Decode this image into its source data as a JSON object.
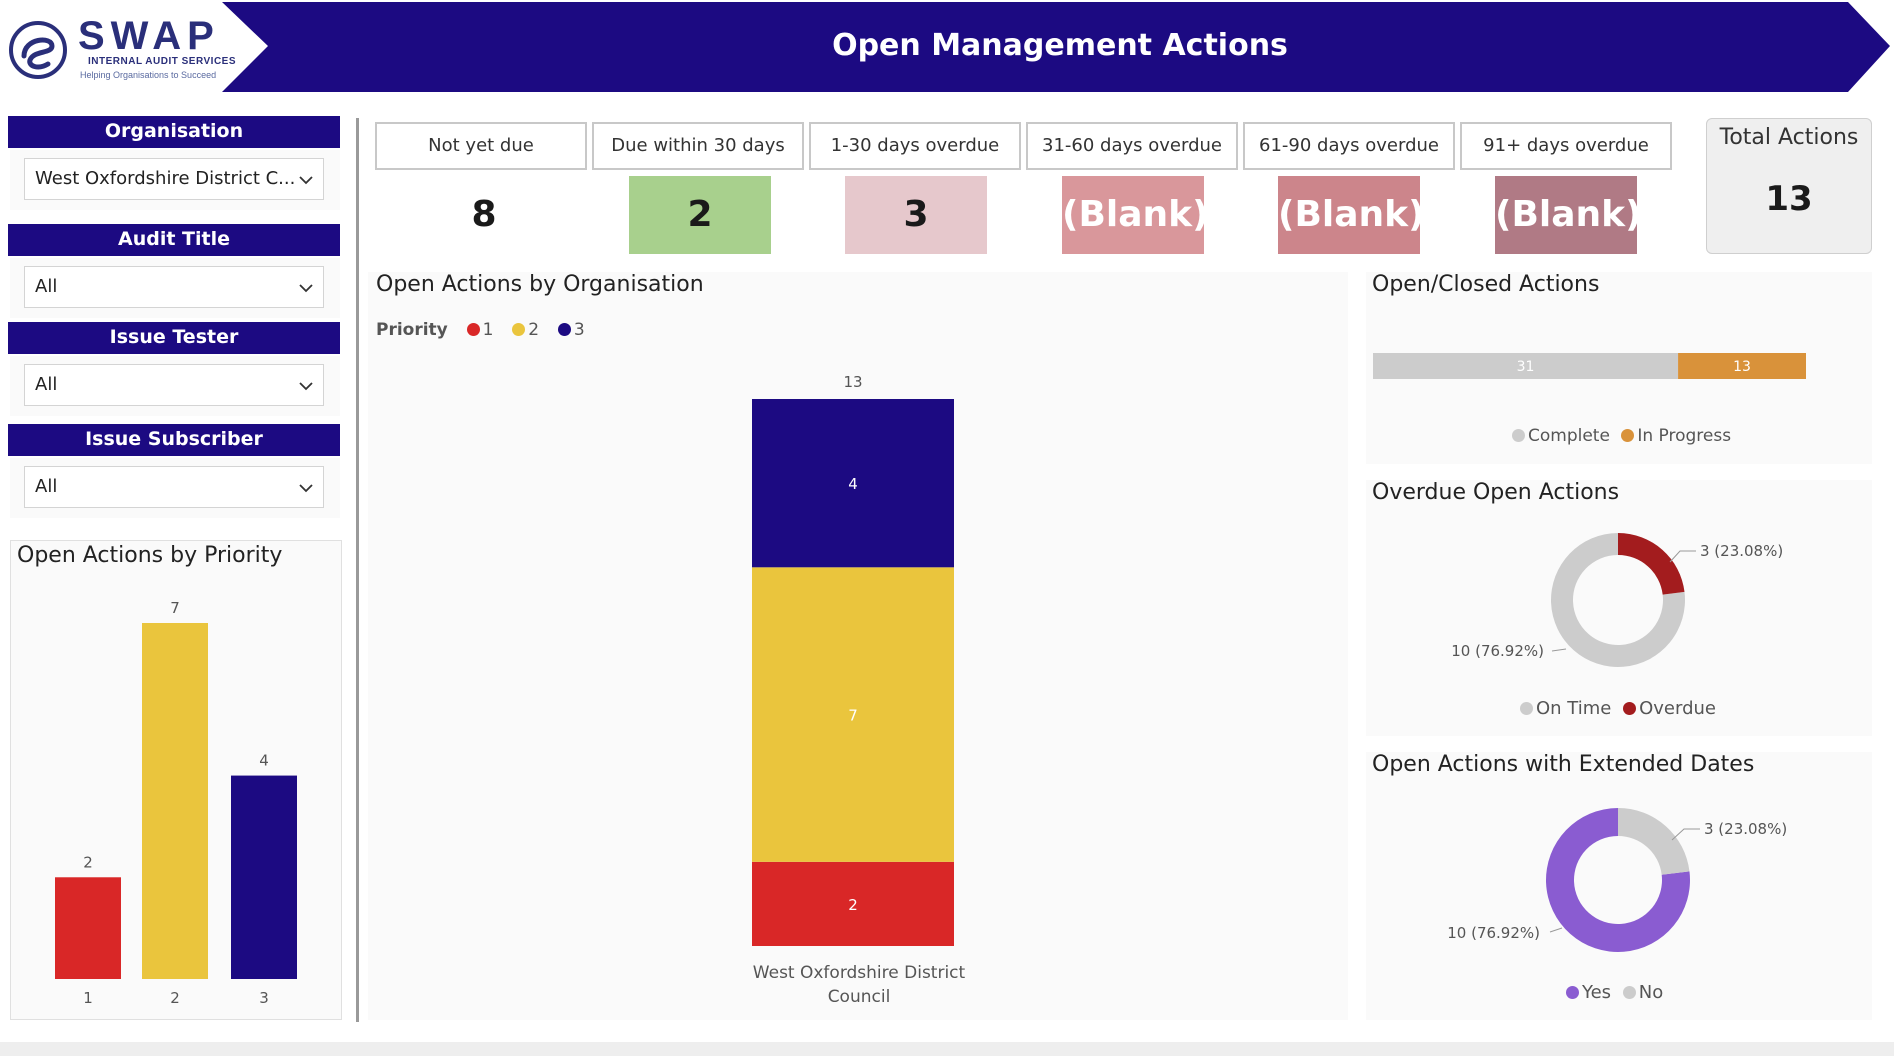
{
  "header": {
    "brand_wordmark": "SWAP",
    "brand_subtitle": "INTERNAL AUDIT SERVICES",
    "brand_tagline": "Helping Organisations to Succeed",
    "title": "Open Management Actions"
  },
  "colors": {
    "header_bg": "#1c0a82",
    "priority_1": "#d92727",
    "priority_2": "#eac53d",
    "priority_3": "#1c0a82",
    "complete": "#cccccc",
    "in_progress": "#d9923a",
    "overdue": "#a31c1e",
    "extended_yes": "#8a5cd1"
  },
  "filters": [
    {
      "label": "Organisation",
      "value": "West Oxfordshire District C..."
    },
    {
      "label": "Audit Title",
      "value": "All"
    },
    {
      "label": "Issue Tester",
      "value": "All"
    },
    {
      "label": "Issue Subscriber",
      "value": "All"
    }
  ],
  "kpis": [
    {
      "label": "Not yet due",
      "value": "8",
      "color": "#ffffff"
    },
    {
      "label": "Due within 30 days",
      "value": "2",
      "color": "#a8d08d"
    },
    {
      "label": "1-30 days overdue",
      "value": "3",
      "color": "#e6c8cc"
    },
    {
      "label": "31-60 days overdue",
      "value": "(Blank)",
      "color": "#d9979b"
    },
    {
      "label": "61-90 days overdue",
      "value": "(Blank)",
      "color": "#cc858b"
    },
    {
      "label": "91+ days overdue",
      "value": "(Blank)",
      "color": "#b07a85"
    }
  ],
  "total_actions": {
    "label": "Total Actions",
    "value": "13"
  },
  "chart_data": [
    {
      "title": "Open Actions by Priority",
      "type": "bar",
      "categories": [
        "1",
        "2",
        "3"
      ],
      "values": [
        2,
        7,
        4
      ],
      "colors": [
        "#d92727",
        "#eac53d",
        "#1c0a82"
      ],
      "ylim": [
        0,
        7
      ]
    },
    {
      "title": "Open Actions by Organisation",
      "type": "bar",
      "stacked": true,
      "legend_title": "Priority",
      "categories": [
        "West Oxfordshire District Council"
      ],
      "category_label_lines": [
        "West Oxfordshire District",
        "Council"
      ],
      "series": [
        {
          "name": "1",
          "values": [
            2
          ],
          "color": "#d92727"
        },
        {
          "name": "2",
          "values": [
            7
          ],
          "color": "#eac53d"
        },
        {
          "name": "3",
          "values": [
            4
          ],
          "color": "#1c0a82"
        }
      ],
      "total_labels": [
        "13"
      ],
      "ylim": [
        0,
        13
      ]
    },
    {
      "title": "Open/Closed Actions",
      "type": "bar",
      "orientation": "horizontal",
      "stacked": true,
      "series": [
        {
          "name": "Complete",
          "values": [
            31
          ],
          "color": "#cccccc"
        },
        {
          "name": "In Progress",
          "values": [
            13
          ],
          "color": "#d9923a"
        }
      ]
    },
    {
      "title": "Overdue Open Actions",
      "type": "pie",
      "donut": true,
      "slices": [
        {
          "name": "On Time",
          "value": 10,
          "label": "10 (76.92%)",
          "color": "#cccccc"
        },
        {
          "name": "Overdue",
          "value": 3,
          "label": "3 (23.08%)",
          "color": "#a31c1e"
        }
      ]
    },
    {
      "title": "Open Actions with Extended Dates",
      "type": "pie",
      "donut": true,
      "slices": [
        {
          "name": "Yes",
          "value": 10,
          "label": "10 (76.92%)",
          "color": "#8a5cd1"
        },
        {
          "name": "No",
          "value": 3,
          "label": "3 (23.08%)",
          "color": "#cccccc"
        }
      ]
    }
  ]
}
